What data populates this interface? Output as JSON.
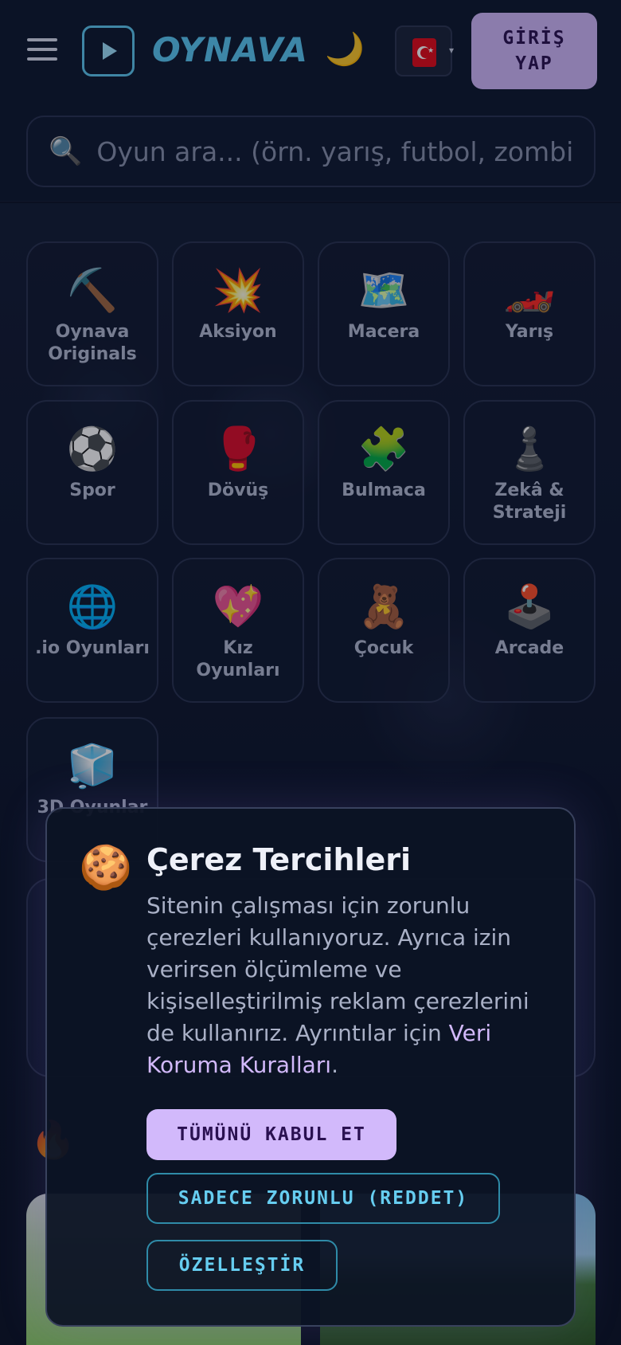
{
  "header": {
    "logo_text": "OYNAVA",
    "login_label": "GİRİŞ YAP",
    "theme_icon": "moon-icon",
    "language_flag": "turkey-flag-icon"
  },
  "search": {
    "placeholder": "Oyun ara... (örn. yarış, futbol, zombi)"
  },
  "categories": [
    {
      "emoji": "⛏️",
      "label": "Oynava Originals"
    },
    {
      "emoji": "💥",
      "label": "Aksiyon"
    },
    {
      "emoji": "🗺️",
      "label": "Macera"
    },
    {
      "emoji": "🏎️",
      "label": "Yarış"
    },
    {
      "emoji": "⚽",
      "label": "Spor"
    },
    {
      "emoji": "🥊",
      "label": "Dövüş"
    },
    {
      "emoji": "🧩",
      "label": "Bulmaca"
    },
    {
      "emoji": "♟️",
      "label": "Zekâ & Strateji"
    },
    {
      "emoji": "🌐",
      "label": ".io Oyunları"
    },
    {
      "emoji": "💖",
      "label": "Kız Oyunları"
    },
    {
      "emoji": "🧸",
      "label": "Çocuk"
    },
    {
      "emoji": "🕹️",
      "label": "Arcade"
    },
    {
      "emoji": "🧊",
      "label": "3D Oyunlar"
    }
  ],
  "cookie_modal": {
    "icon": "🍪",
    "title": "Çerez Tercihleri",
    "text": "Sitenin çalışması için zorunlu çerezleri kullanıyoruz. Ayrıca izin verirsen ölçümleme ve kişiselleştirilmiş reklam çerezlerini de kullanırız. Ayrıntılar için ",
    "link_label": "Veri Koruma Kuralları",
    "text_end": ".",
    "accept_label": "TÜMÜNÜ KABUL ET",
    "reject_label": "SADECE ZORUNLU (REDDET)",
    "customize_label": "ÖZELLEŞTİR"
  },
  "colors": {
    "background": "#0b1326",
    "accent_purple": "#d2b9fb",
    "accent_cyan": "#5ac8f3"
  }
}
